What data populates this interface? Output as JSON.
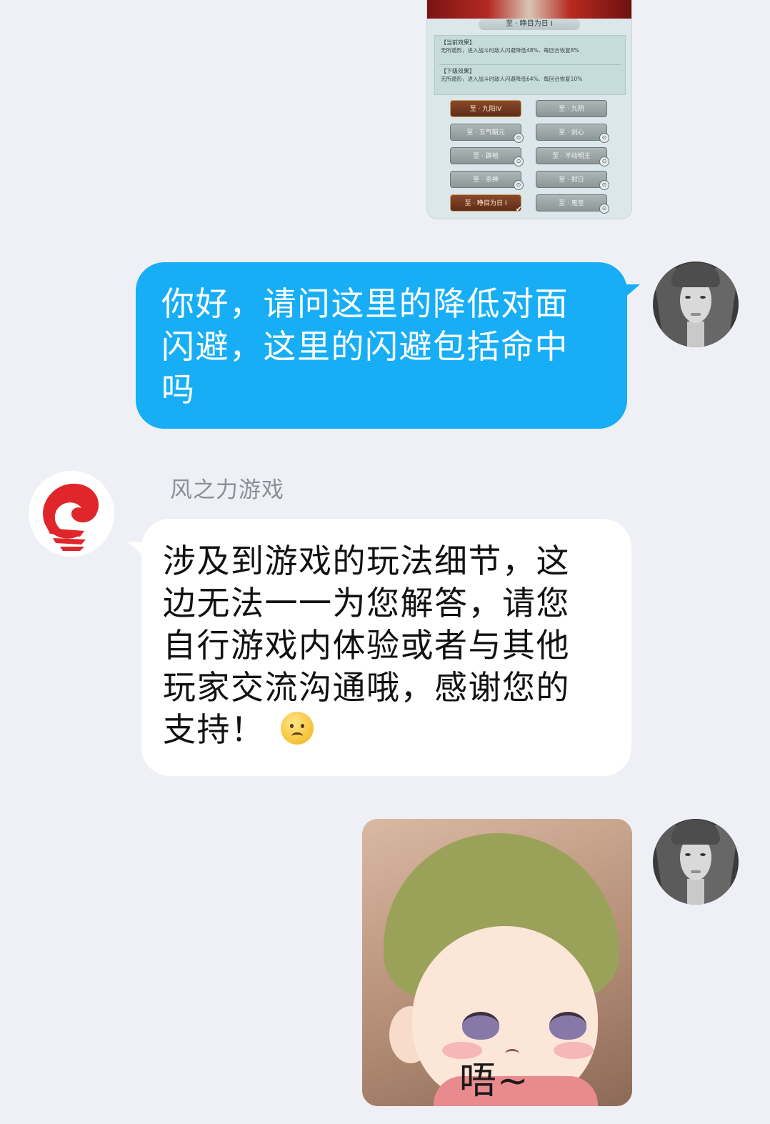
{
  "game_card": {
    "title": "至 · 睁目为日 I",
    "current_effect_head": "【当前效果】",
    "current_effect_text": "无所遁形，进入战斗时敌人闪避降低48%、每回合恢复8%",
    "next_effect_head": "【下级效果】",
    "next_effect_text": "无所遁形，进入战斗时敌人闪避降低64%、每回合恢复10%",
    "skills": [
      {
        "label": "至 · 九阳IV",
        "state": "active",
        "icon": ""
      },
      {
        "label": "至 · 九阴",
        "state": "locked",
        "icon": ""
      },
      {
        "label": "至 · 五气朝元",
        "state": "locked",
        "icon": "lock-icon"
      },
      {
        "label": "至 · 剑心",
        "state": "locked",
        "icon": "lock-icon"
      },
      {
        "label": "至 · 辟地",
        "state": "locked",
        "icon": "lock-icon"
      },
      {
        "label": "至 · 不动明王",
        "state": "locked",
        "icon": "lock-icon"
      },
      {
        "label": "至 · 杀神",
        "state": "locked",
        "icon": "lock-icon"
      },
      {
        "label": "至 · 射日",
        "state": "locked",
        "icon": "lock-icon"
      },
      {
        "label": "至 · 睁目为日 I",
        "state": "active",
        "icon": "check-icon"
      },
      {
        "label": "至 · 鬼圣",
        "state": "locked",
        "icon": "lock-icon"
      }
    ]
  },
  "messages": {
    "user_question": "你好，请问这里的降低对面闪避，这里的闪避包括命中吗",
    "sender_name": "风之力游戏",
    "support_reply": "涉及到游戏的玩法细节，这边无法一一为您解答，请您自行游戏内体验或者与其他玩家交流沟通哦，感谢您的支持！",
    "sticker_caption": "唔~"
  },
  "colors": {
    "background": "#eef0f6",
    "user_bubble": "#17aef5",
    "reply_bubble": "#ffffff",
    "brand_red": "#e0262b"
  }
}
